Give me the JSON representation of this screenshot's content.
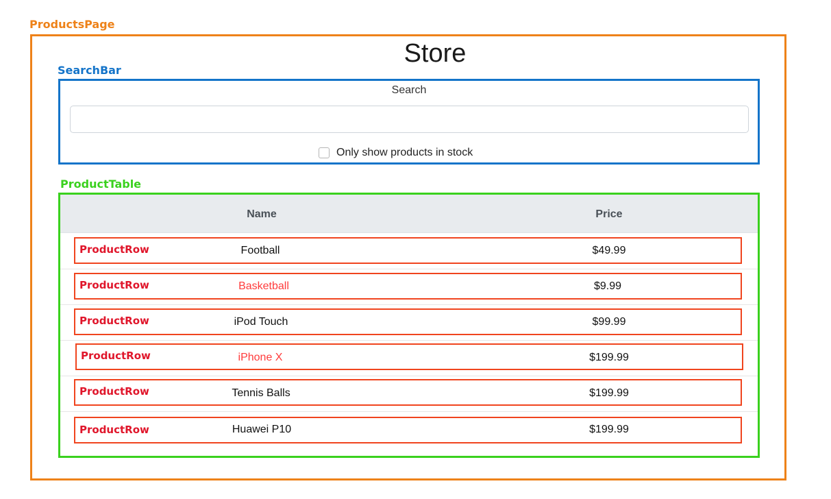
{
  "components": {
    "products_page": "ProductsPage",
    "search_bar": "SearchBar",
    "product_table": "ProductTable",
    "product_row": "ProductRow"
  },
  "app": {
    "title": "Store"
  },
  "search": {
    "label": "Search",
    "value": "",
    "placeholder": "",
    "in_stock_only_label": "Only show products  in stock",
    "in_stock_only_checked": false
  },
  "table": {
    "headers": {
      "name": "Name",
      "price": "Price"
    },
    "rows": [
      {
        "name": "Football",
        "price": "$49.99",
        "stocked": true
      },
      {
        "name": "Basketball",
        "price": "$9.99",
        "stocked": false
      },
      {
        "name": "iPod Touch",
        "price": "$99.99",
        "stocked": true
      },
      {
        "name": "iPhone X",
        "price": "$199.99",
        "stocked": false
      },
      {
        "name": "Tennis Balls",
        "price": "$199.99",
        "stocked": true
      },
      {
        "name": "Huawei P10",
        "price": "$199.99",
        "stocked": true
      }
    ]
  },
  "colors": {
    "products_page_border": "#ee8219",
    "search_bar_border": "#1474c9",
    "product_table_border": "#3ad11e",
    "product_row_border": "#f0441e",
    "out_of_stock_text": "#ff3b3b"
  }
}
